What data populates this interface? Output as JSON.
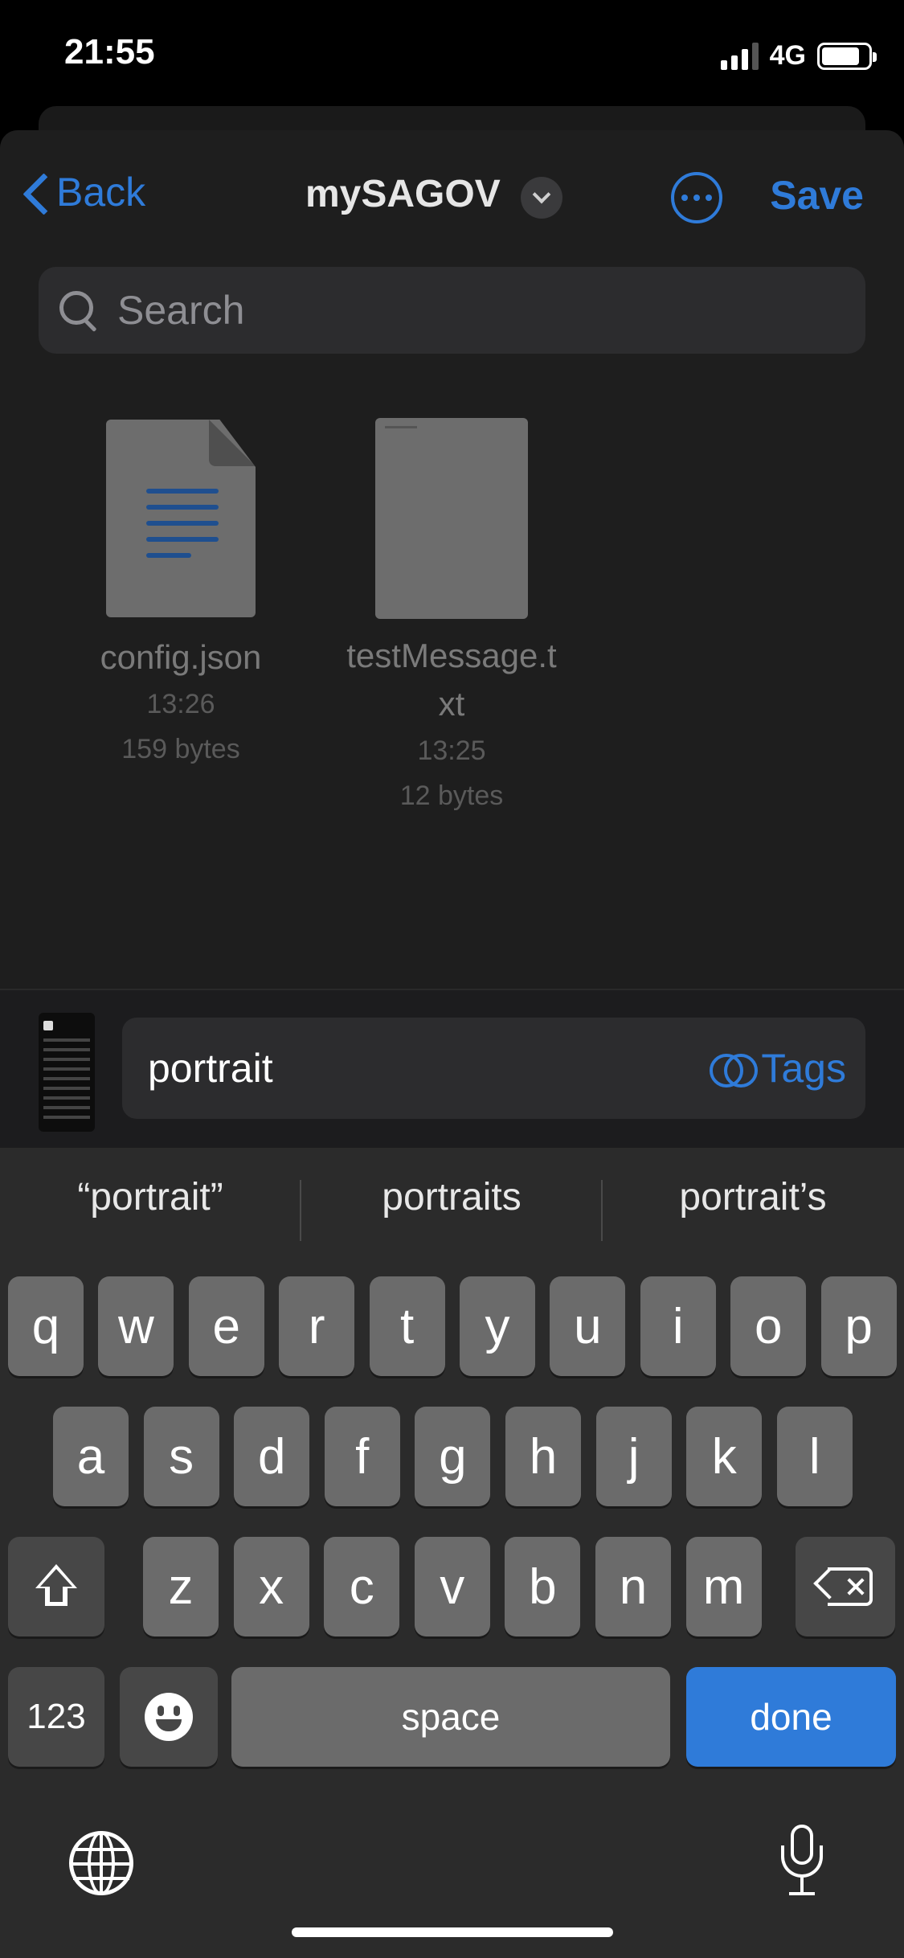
{
  "status_bar": {
    "time": "21:55",
    "network": "4G"
  },
  "nav": {
    "back_label": "Back",
    "title": "mySAGOV",
    "save_label": "Save"
  },
  "search": {
    "placeholder": "Search"
  },
  "files": [
    {
      "name": "config.json",
      "time": "13:26",
      "size": "159 bytes",
      "icon": "document-icon"
    },
    {
      "name_line1": "testMessage.t",
      "name_line2": "xt",
      "time": "13:25",
      "size": "12 bytes",
      "icon": "text-file-icon"
    }
  ],
  "name_bar": {
    "value": "portrait",
    "tags_label": "Tags"
  },
  "keyboard": {
    "suggestions": [
      "“portrait”",
      "portraits",
      "portrait’s"
    ],
    "row1": [
      "q",
      "w",
      "e",
      "r",
      "t",
      "y",
      "u",
      "i",
      "o",
      "p"
    ],
    "row2": [
      "a",
      "s",
      "d",
      "f",
      "g",
      "h",
      "j",
      "k",
      "l"
    ],
    "row3": [
      "z",
      "x",
      "c",
      "v",
      "b",
      "n",
      "m"
    ],
    "numbers_label": "123",
    "space_label": "space",
    "done_label": "done"
  },
  "colors": {
    "accent": "#2f7bd9",
    "sheet": "#1e1e1e",
    "key": "#6b6b6b",
    "key_fn": "#474747"
  }
}
